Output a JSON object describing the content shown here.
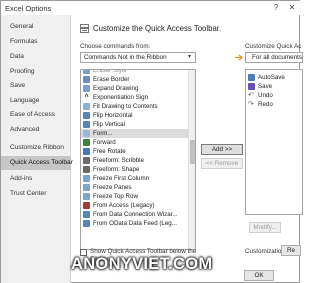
{
  "window": {
    "title": "Excel Options",
    "help_glyph": "?",
    "close_glyph": "✕"
  },
  "sidebar": {
    "items": [
      {
        "label": "General",
        "active": false
      },
      {
        "label": "Formulas",
        "active": false
      },
      {
        "label": "Data",
        "active": false
      },
      {
        "label": "Proofing",
        "active": false
      },
      {
        "label": "Save",
        "active": false
      },
      {
        "label": "Language",
        "active": false
      },
      {
        "label": "Ease of Access",
        "active": false
      },
      {
        "label": "Advanced",
        "active": false
      },
      {
        "label": "Customize Ribbon",
        "active": false
      },
      {
        "label": "Quick Access Toolbar",
        "active": true
      },
      {
        "label": "Add-ins",
        "active": false
      },
      {
        "label": "Trust Center",
        "active": false
      }
    ]
  },
  "main": {
    "header_title": "Customize the Quick Access Toolbar.",
    "choose_label": "Choose commands from:",
    "choose_value": "Commands Not in the Ribbon",
    "customize_label": "Customize Quick Ac",
    "customize_value": "For all documents",
    "commands": [
      {
        "label": "Erase Border",
        "icon": "#6b8fb8"
      },
      {
        "label": "Expand Drawing",
        "icon": "#7aa0c8"
      },
      {
        "label": "Exponentiation Sign",
        "icon": "#333333"
      },
      {
        "label": "Fit Drawing to Contents",
        "icon": "#8fb0d0"
      },
      {
        "label": "Flip Horizontal",
        "icon": "#5a84b6"
      },
      {
        "label": "Flip Vertical",
        "icon": "#5a84b6"
      },
      {
        "label": "Form...",
        "icon": "#9bb7d4",
        "selected": true
      },
      {
        "label": "Forward",
        "icon": "#3f7f3f"
      },
      {
        "label": "Free Rotate",
        "icon": "#4a78b0"
      },
      {
        "label": "Freeform: Scribble",
        "icon": "#6a6a6a"
      },
      {
        "label": "Freeform: Shape",
        "icon": "#6a6a6a"
      },
      {
        "label": "Freeze First Column",
        "icon": "#7da4cc"
      },
      {
        "label": "Freeze Panes",
        "icon": "#7da4cc"
      },
      {
        "label": "Freeze Top Row",
        "icon": "#7da4cc"
      },
      {
        "label": "From Access (Legacy)",
        "icon": "#a33a3a"
      },
      {
        "label": "From Data Connection Wizar...",
        "icon": "#5a84b6"
      },
      {
        "label": "From OData Data Feed (Leg...",
        "icon": "#5a84b6"
      }
    ],
    "qat_items": [
      {
        "label": "AutoSave",
        "icon": "#4a7bbf"
      },
      {
        "label": "Save",
        "icon": "#6b4fbf"
      },
      {
        "label": "Undo",
        "icon": "#5a5a5a"
      },
      {
        "label": "Redo",
        "icon": "#5a5a5a"
      }
    ],
    "add_button": "Add >>",
    "remove_button": "<< Remove",
    "modify_button": "Modify...",
    "show_below_line1": "Show Quick Access Toolbar below the",
    "show_below_line2": "Ribbon",
    "customizations_label": "Customizations:",
    "reset_button": "Re",
    "ok_button": "OK"
  },
  "watermark": "ANONYVIET.COM"
}
